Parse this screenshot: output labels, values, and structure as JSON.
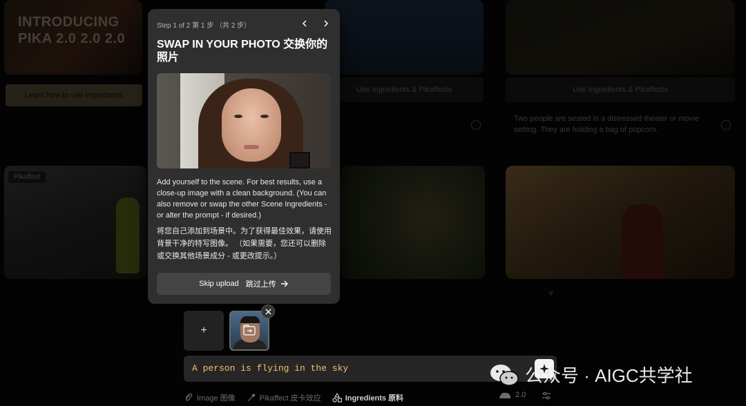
{
  "background": {
    "intro_title": "INTRODUCING PIKA 2.0 2.0 2.0",
    "learn_button": "Learn how to use Ingredients",
    "card2_button": "Use Ingredients & Pikaffects",
    "card3_button": "Use Ingredients & Pikaffects",
    "card3_text": "Two people are seated in a distressed theater or movie setting. They are holding a bag of popcorn.",
    "card_tag": "Pikaffect"
  },
  "popover": {
    "step": "Step 1 of 2 第 1 步 （共 2 步）",
    "title": "SWAP IN YOUR PHOTO 交换你的照片",
    "description_en": "Add yourself to the scene. For best results, use a close-up image with a clean background. (You can also remove or swap the other Scene Ingredients - or alter the prompt - if desired.)",
    "description_zh": "将您自己添加到场景中。为了获得最佳效果，请使用背景干净的特写图像。 （如果需要，您还可以删除或交换其他场景成分 - 或更改提示。）",
    "skip_en": "Skip upload",
    "skip_zh": "跳过上传"
  },
  "composer": {
    "add_label": "+",
    "prompt": "A person is flying in the sky"
  },
  "toolbar": {
    "image": "Image 图像",
    "pikaffect": "Pikaffect 皮卡效应",
    "ingredients": "Ingredients 原料",
    "model": "2.0"
  },
  "watermark": {
    "text": "公众号 · AIGC共学社"
  }
}
